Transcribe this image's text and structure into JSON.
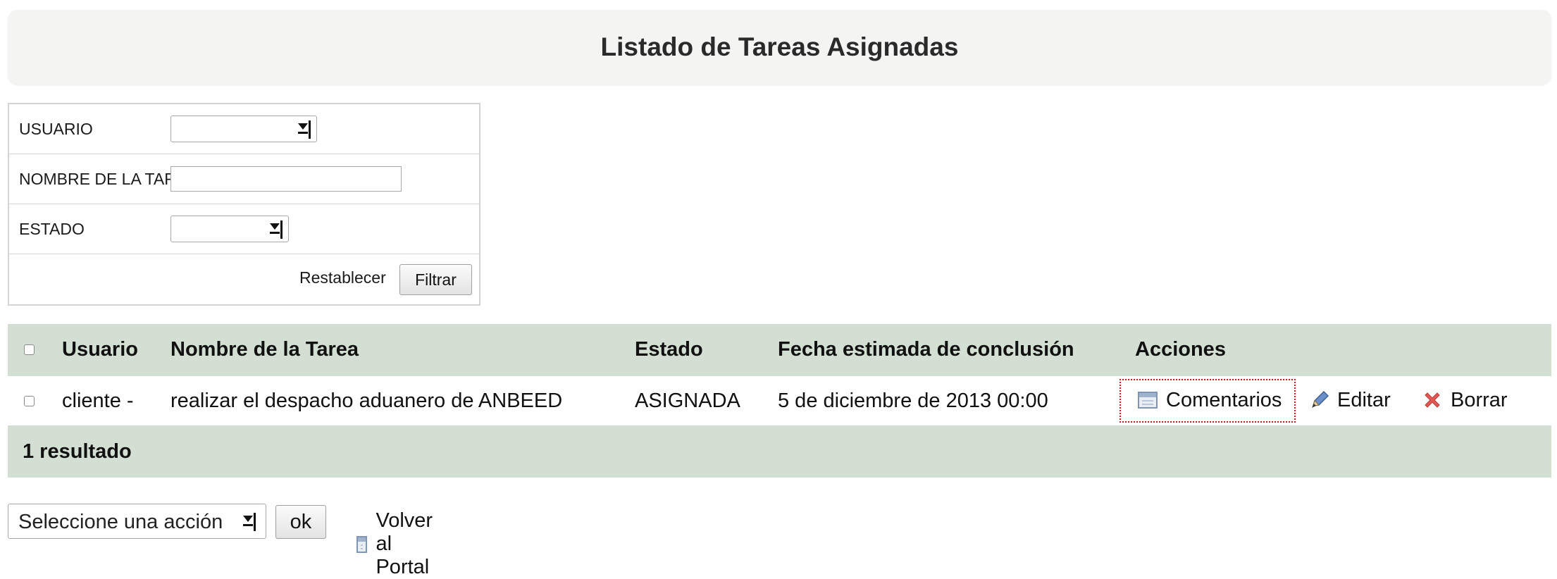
{
  "page": {
    "title": "Listado de Tareas Asignadas"
  },
  "filters": {
    "usuario_label": "USUARIO",
    "usuario_value": "",
    "tarea_label": "NOMBRE DE LA TAREA",
    "tarea_value": "",
    "estado_label": "ESTADO",
    "estado_value": "",
    "reset_label": "Restablecer",
    "filter_label": "Filtrar"
  },
  "table": {
    "columns": [
      "Usuario",
      "Nombre de la Tarea",
      "Estado",
      "Fecha estimada de conclusión",
      "Acciones"
    ],
    "rows": [
      {
        "usuario": "cliente -",
        "tarea": "realizar el despacho aduanero de ANBEED",
        "estado": "ASIGNADA",
        "fecha": "5 de diciembre de 2013 00:00",
        "actions": [
          "Comentarios",
          "Editar",
          "Borrar"
        ]
      }
    ],
    "footer": "1 resultado"
  },
  "bottom": {
    "action_select_value": "Seleccione una acción",
    "ok_label": "ok",
    "back_label": "Volver al Portal"
  },
  "colors": {
    "header_bg": "#d3dfd2",
    "title_bg": "#f4f4f2",
    "focus_outline": "#dd1111",
    "delete_icon": "#e0504a",
    "edit_icon": "#5b7fb8"
  },
  "icons": {
    "comentarios": "document-icon",
    "editar": "pencil-icon",
    "borrar": "delete-x-icon",
    "volver": "document-icon"
  }
}
